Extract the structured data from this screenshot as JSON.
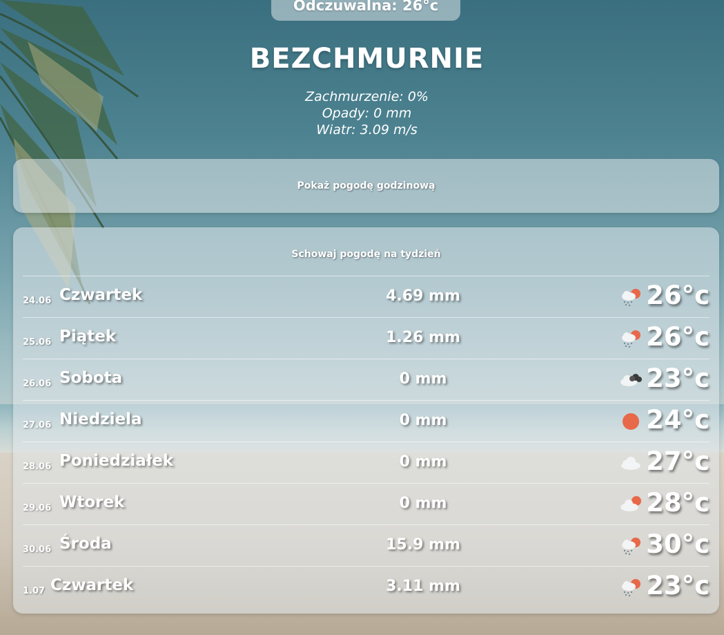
{
  "header": {
    "feels_like": "Odczuwalna: 26°c",
    "condition": "BEZCHMURNIE",
    "cloudiness": "Zachmurzenie: 0%",
    "precipitation": "Opady: 0 mm",
    "wind": "Wiatr: 3.09 m/s"
  },
  "hourly": {
    "button_label": "Pokaż pogodę godzinową"
  },
  "weekly": {
    "button_label": "Schowaj pogodę na tydzień",
    "days": [
      {
        "date": "24.06",
        "day": "Czwartek",
        "rain": "4.69 mm",
        "icon": "rain-sun-icon",
        "temp": "26°c"
      },
      {
        "date": "25.06",
        "day": "Piątek",
        "rain": "1.26 mm",
        "icon": "rain-sun-icon",
        "temp": "26°c"
      },
      {
        "date": "26.06",
        "day": "Sobota",
        "rain": "0 mm",
        "icon": "dark-clouds-icon",
        "temp": "23°c"
      },
      {
        "date": "27.06",
        "day": "Niedziela",
        "rain": "0 mm",
        "icon": "sun-icon",
        "temp": "24°c"
      },
      {
        "date": "28.06",
        "day": "Poniedziałek",
        "rain": "0 mm",
        "icon": "cloud-icon",
        "temp": "27°c"
      },
      {
        "date": "29.06",
        "day": "Wtorek",
        "rain": "0 mm",
        "icon": "cloud-sun-icon",
        "temp": "28°c"
      },
      {
        "date": "30.06",
        "day": "Środa",
        "rain": "15.9 mm",
        "icon": "rain-sun-icon",
        "temp": "30°c"
      },
      {
        "date": "1.07",
        "day": "Czwartek",
        "rain": "3.11 mm",
        "icon": "rain-sun-icon",
        "temp": "23°c"
      }
    ]
  },
  "colors": {
    "sun": "#e8684a",
    "cloud": "#f2f4f5",
    "dark_cloud": "#3b3b3b",
    "rain": "#7a8a94"
  }
}
